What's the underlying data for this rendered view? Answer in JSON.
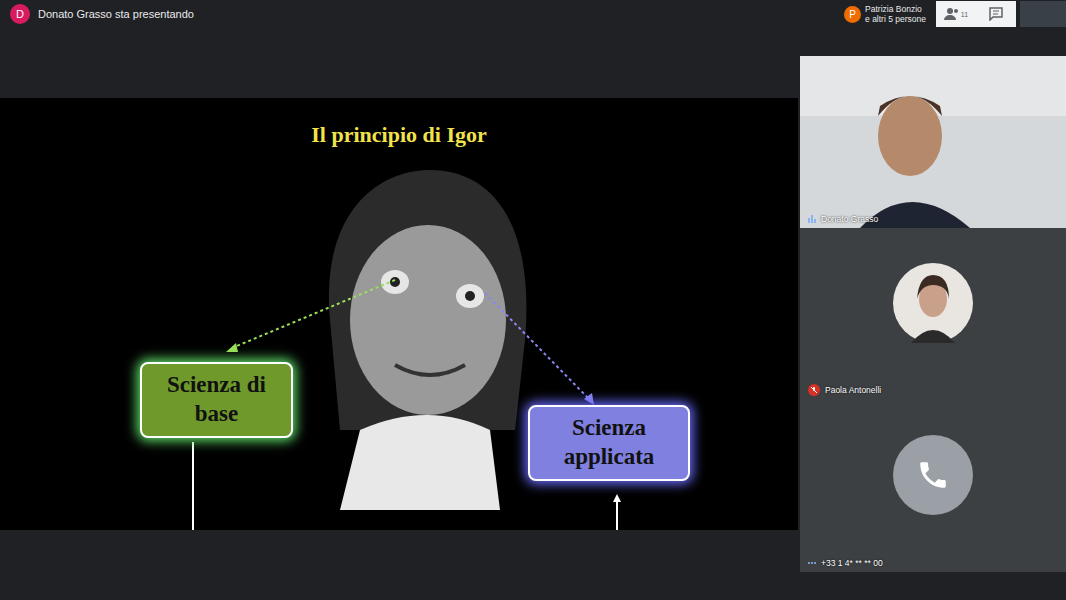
{
  "header": {
    "presenter_initial": "D",
    "presenter_text": "Donato Grasso sta presentando",
    "participants_initial": "P",
    "participants_line1": "Patrizia Bonzio",
    "participants_line2": "e altri 5 persone",
    "people_count": "11"
  },
  "slide": {
    "title": "Il principio di Igor",
    "boxes": [
      {
        "label": "Scienza di base",
        "color": "#6f9a2b"
      },
      {
        "label": "Scienza applicata",
        "color": "#7f80e0"
      }
    ]
  },
  "participants": [
    {
      "name": "Donato Grasso",
      "kind": "video",
      "muted": false,
      "speaking": true
    },
    {
      "name": "Paola Antonelli",
      "kind": "avatar",
      "muted": true,
      "speaking": false
    },
    {
      "name": "+33 1 4* ** ** 00",
      "kind": "phone",
      "muted": false,
      "speaking": true
    }
  ]
}
